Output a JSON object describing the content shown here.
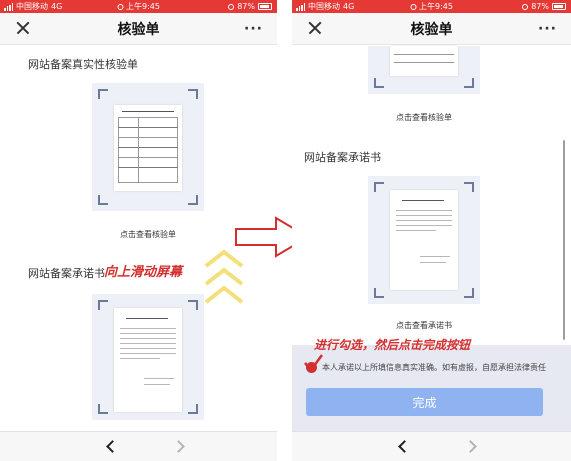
{
  "status_bar": {
    "carrier": "中国移动",
    "network": "4G",
    "time": "上午9:45",
    "battery": "87%"
  },
  "nav": {
    "title": "核验单",
    "more": "···"
  },
  "left_screen": {
    "section1_title": "网站备案真实性核验单",
    "section1_link": "点击查看核验单",
    "section2_title": "网站备案承诺书",
    "annotation": "向上滑动屏幕"
  },
  "right_screen": {
    "top_link": "点击查看核验单",
    "section_title": "网站备案承诺书",
    "section_link": "点击查看承诺书",
    "annotation": "进行勾选，然后点击完成按钮",
    "agree_text": "本人承诺以上所填信息真实准确。如有虚报，自愿承担法律责任",
    "finish_button": "完成"
  },
  "colors": {
    "status_bar": "#e53935",
    "annotation": "#d32f2f",
    "button": "#8fb2f0",
    "frame": "#eef0f8"
  },
  "icons": {
    "close": "close-icon",
    "more": "more-icon",
    "back": "chevron-left-icon",
    "forward": "chevron-right-icon",
    "arrow": "right-arrow-icon",
    "swipe": "chevron-up-stack-icon"
  }
}
